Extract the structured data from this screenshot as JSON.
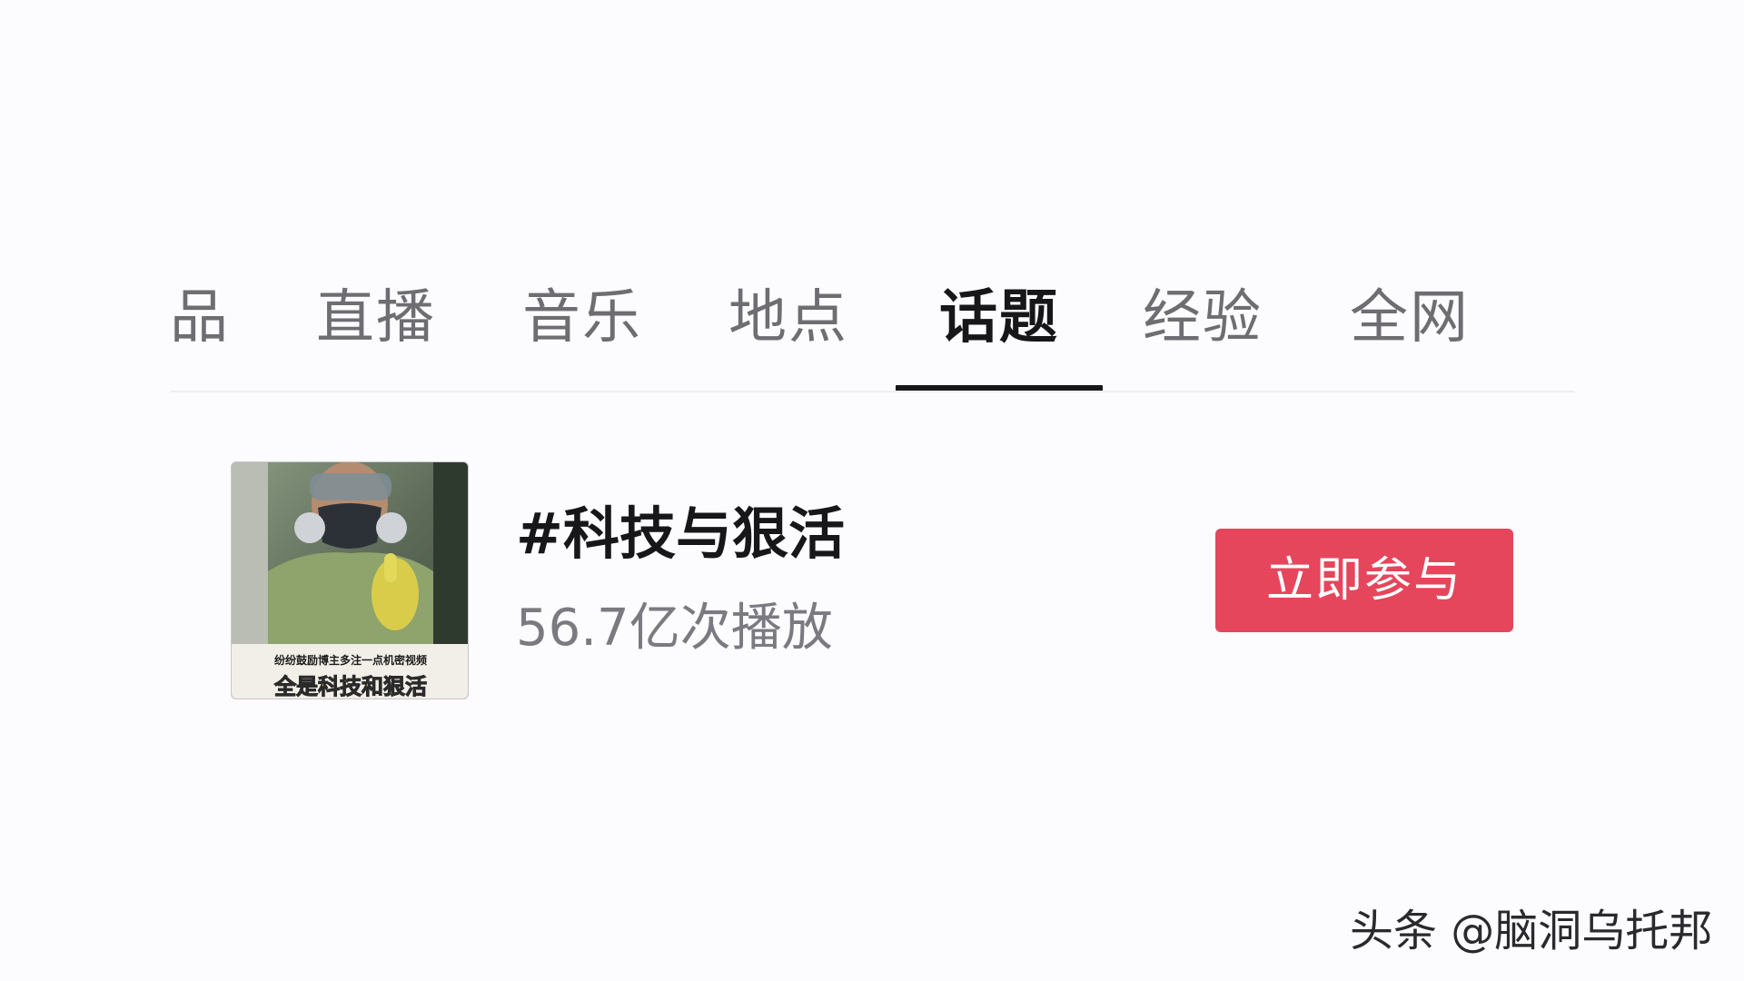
{
  "tabs": [
    {
      "label": "品",
      "active": false
    },
    {
      "label": "直播",
      "active": false
    },
    {
      "label": "音乐",
      "active": false
    },
    {
      "label": "地点",
      "active": false
    },
    {
      "label": "话题",
      "active": true
    },
    {
      "label": "经验",
      "active": false
    },
    {
      "label": "全网",
      "active": false
    }
  ],
  "topic": {
    "title": "#科技与狠活",
    "plays": "56.7亿次播放",
    "join_label": "立即参与",
    "thumbnail": {
      "caption_small": "纷纷鼓励博主多注一点机密视频",
      "caption_large": "全是科技和狠活"
    }
  },
  "watermark": "头条 @脑洞乌托邦",
  "colors": {
    "accent": "#e5465c",
    "active_tab": "#17171a",
    "inactive_tab": "#6e6e72",
    "background": "#fcfbfe"
  }
}
